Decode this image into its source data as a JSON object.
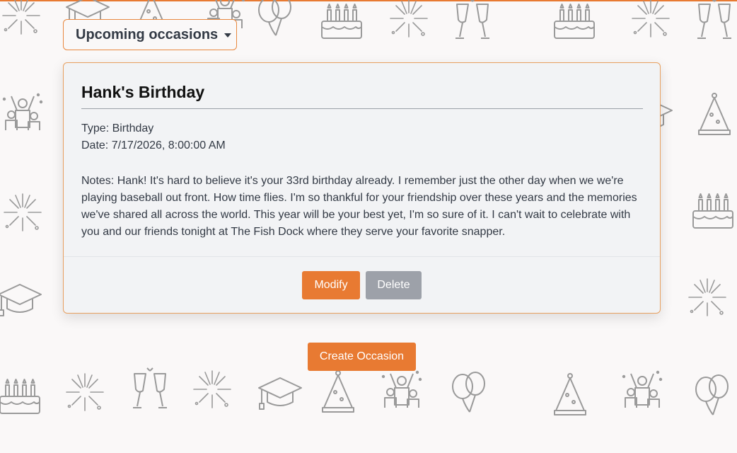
{
  "dropdown": {
    "label": "Upcoming occasions"
  },
  "occasion": {
    "title": "Hank's Birthday",
    "type": "Type: Birthday",
    "date": "Date: 7/17/2026, 8:00:00 AM",
    "notes": "Notes: Hank! It's hard to believe it's your 33rd birthday already. I remember just the other day when we we're playing baseball out front. How time flies. I'm so thankful for your friendship over these years and the memories we've shared all across the world. This year will be your best yet, I'm so sure of it. I can't wait to celebrate with you and our friends tonight at The Fish Dock where they serve your favorite snapper."
  },
  "actions": {
    "modify": "Modify",
    "delete": "Delete",
    "create": "Create Occasion"
  },
  "colors": {
    "accent": "#e87a32",
    "secondary": "#9da1a9",
    "icon": "#9a9a9a"
  },
  "background_icons": [
    "fireworks-icon",
    "graduation-cap-icon",
    "party-hat-icon",
    "celebrating-people-icon",
    "balloons-icon",
    "birthday-cake-icon",
    "champagne-toast-icon"
  ]
}
